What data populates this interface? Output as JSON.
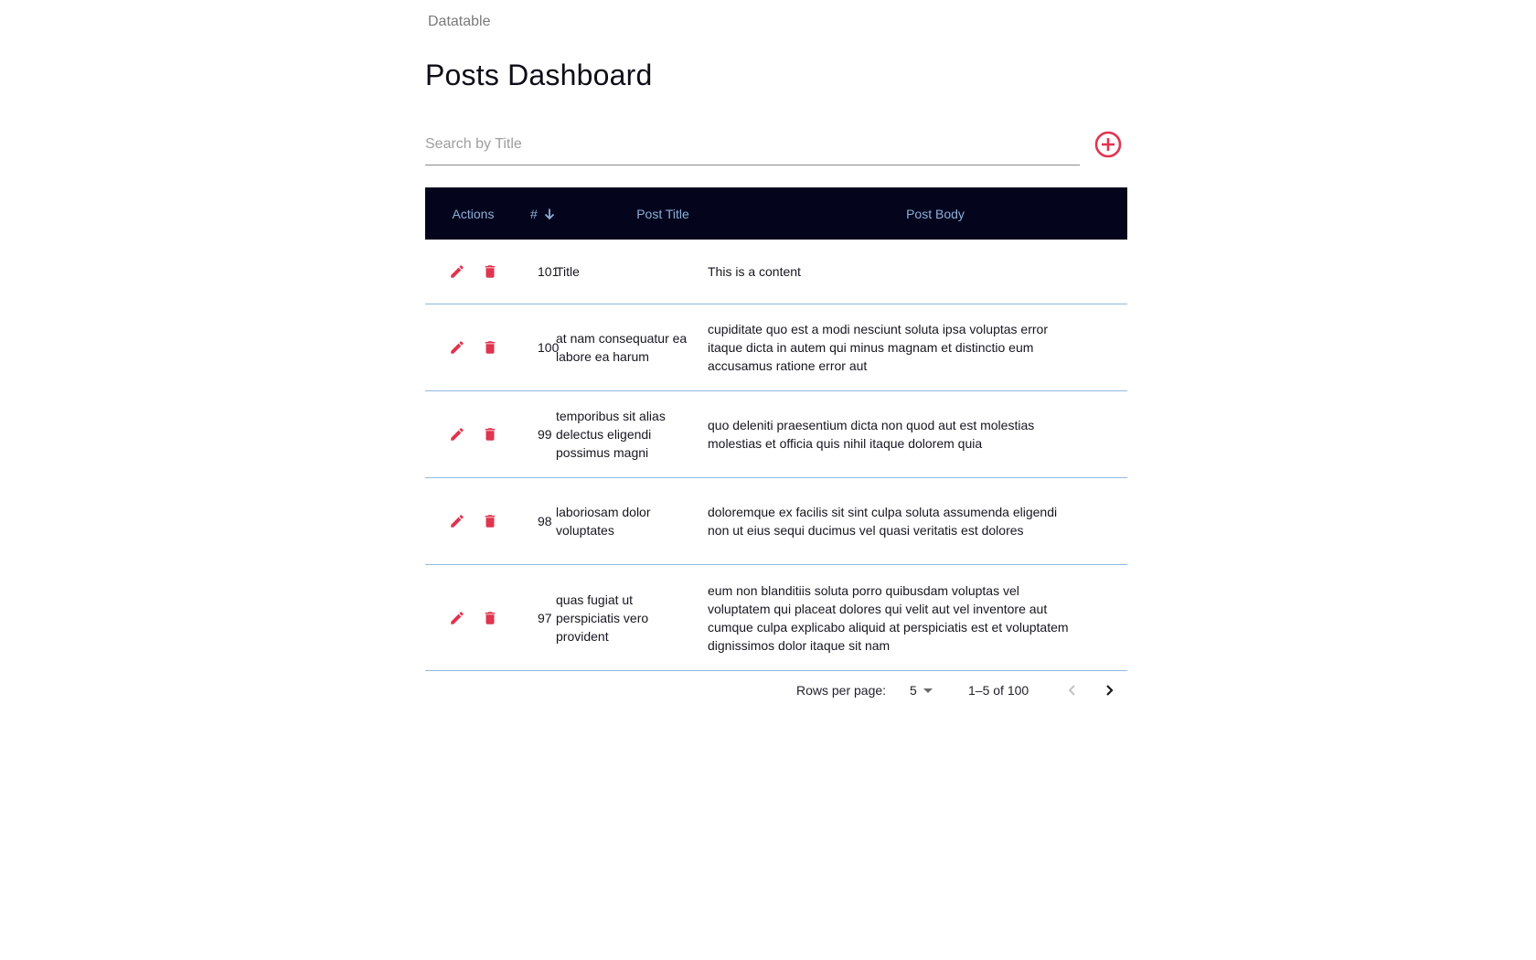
{
  "app": {
    "label": "Datatable"
  },
  "page": {
    "title": "Posts Dashboard"
  },
  "search": {
    "placeholder": "Search by Title"
  },
  "colors": {
    "accent": "#e0344f",
    "header_bg": "#04041c",
    "header_text": "#8cb0d8",
    "divider": "#8fbbe0"
  },
  "table": {
    "headers": {
      "actions": "Actions",
      "id": "#",
      "title": "Post Title",
      "body": "Post Body"
    },
    "sort": {
      "column": "id",
      "direction": "descending",
      "icon": "arrow-down-icon"
    },
    "rows": [
      {
        "id": "101",
        "title": "Title",
        "body": "This is a content"
      },
      {
        "id": "100",
        "title": "at nam consequatur ea labore ea harum",
        "body": "cupiditate quo est a modi nesciunt soluta ipsa voluptas error itaque dicta in autem qui minus magnam et distinctio eum accusamus ratione error aut"
      },
      {
        "id": "99",
        "title": "temporibus sit alias delectus eligendi possimus magni",
        "body": "quo deleniti praesentium dicta non quod aut est molestias molestias et officia quis nihil itaque dolorem quia"
      },
      {
        "id": "98",
        "title": "laboriosam dolor voluptates",
        "body": "doloremque ex facilis sit sint culpa soluta assumenda eligendi non ut eius sequi ducimus vel quasi veritatis est dolores"
      },
      {
        "id": "97",
        "title": "quas fugiat ut perspiciatis vero provident",
        "body": "eum non blanditiis soluta porro quibusdam voluptas vel voluptatem qui placeat dolores qui velit aut vel inventore aut cumque culpa explicabo aliquid at perspiciatis est et voluptatem dignissimos dolor itaque sit nam"
      }
    ]
  },
  "pagination": {
    "rows_per_page_label": "Rows per page:",
    "rows_per_page_value": "5",
    "range": "1–5 of 100"
  }
}
